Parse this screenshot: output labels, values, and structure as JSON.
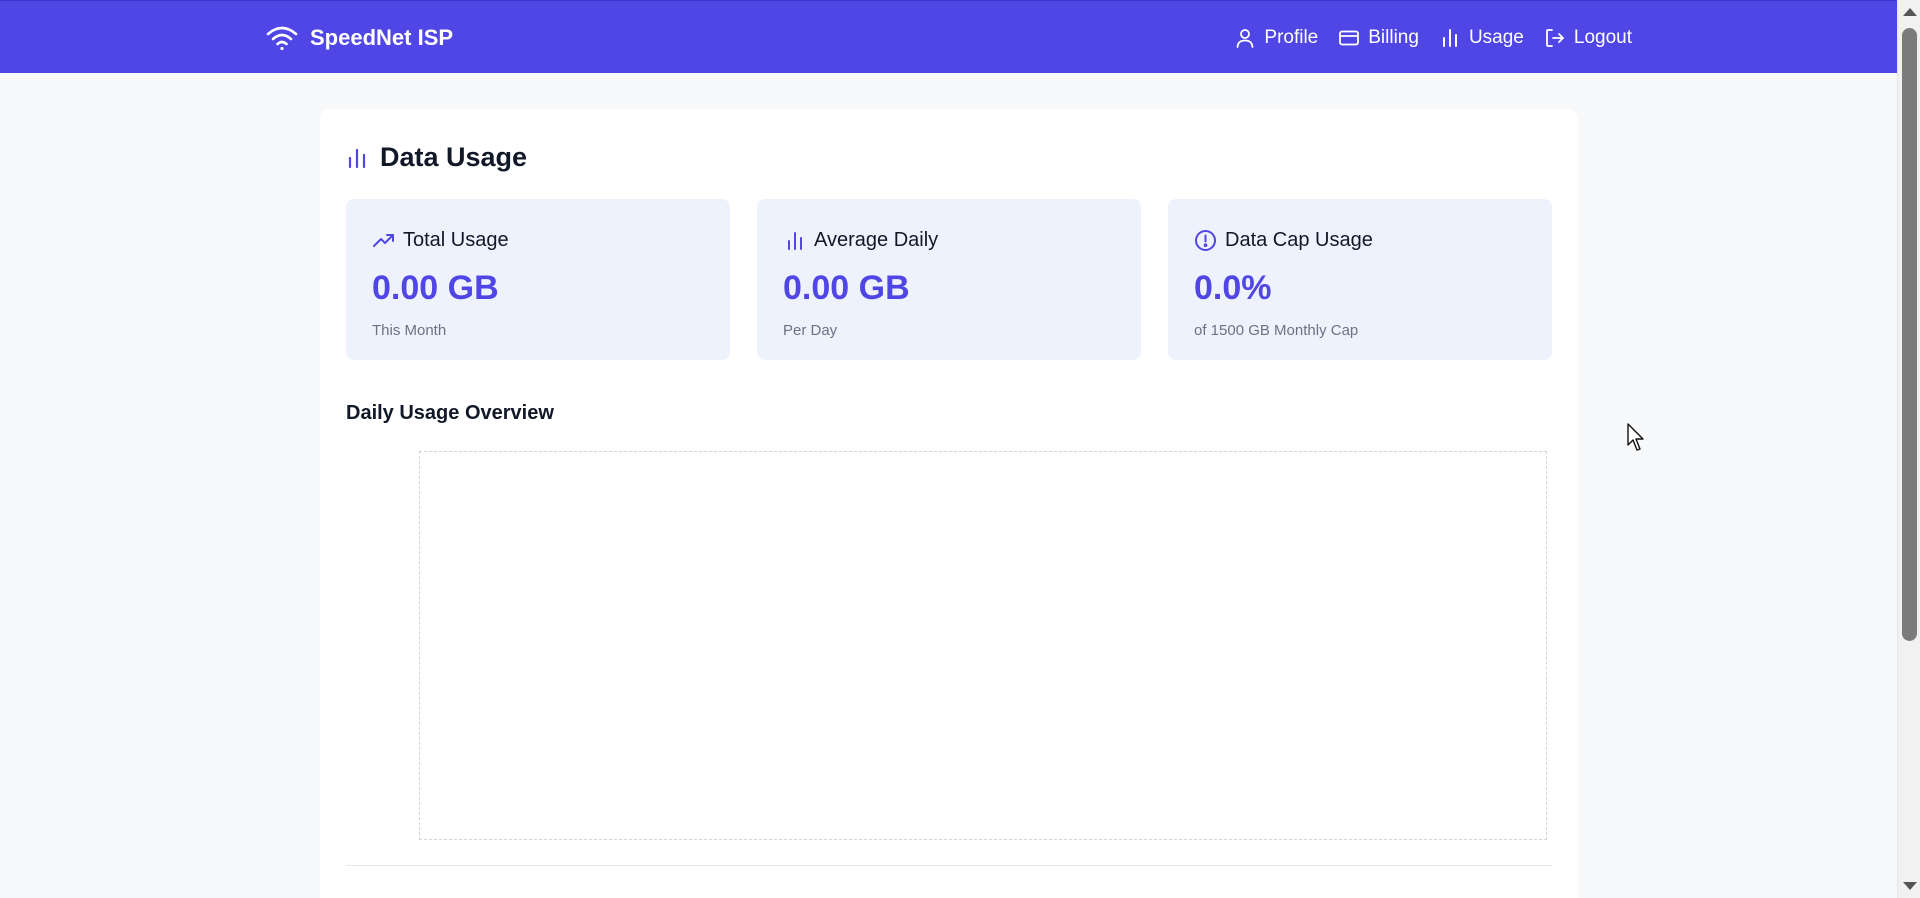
{
  "brand": {
    "name": "SpeedNet ISP",
    "icon": "wifi-icon"
  },
  "nav": {
    "items": [
      {
        "label": "Profile",
        "icon": "user-icon"
      },
      {
        "label": "Billing",
        "icon": "credit-card-icon"
      },
      {
        "label": "Usage",
        "icon": "bar-chart-icon"
      },
      {
        "label": "Logout",
        "icon": "logout-icon"
      }
    ]
  },
  "page": {
    "title": "Data Usage",
    "icon": "bar-chart-icon"
  },
  "cards": [
    {
      "title": "Total Usage",
      "value": "0.00 GB",
      "subtitle": "This Month",
      "icon": "trending-up-icon"
    },
    {
      "title": "Average Daily",
      "value": "0.00 GB",
      "subtitle": "Per Day",
      "icon": "bar-chart-icon"
    },
    {
      "title": "Data Cap Usage",
      "value": "0.0%",
      "subtitle": "of 1500 GB Monthly Cap",
      "icon": "alert-circle-icon"
    }
  ],
  "chart": {
    "title": "Daily Usage Overview"
  },
  "colors": {
    "brand": "#4f46e5",
    "card_bg": "#eef2fd",
    "page_bg": "#f8f9fb"
  }
}
